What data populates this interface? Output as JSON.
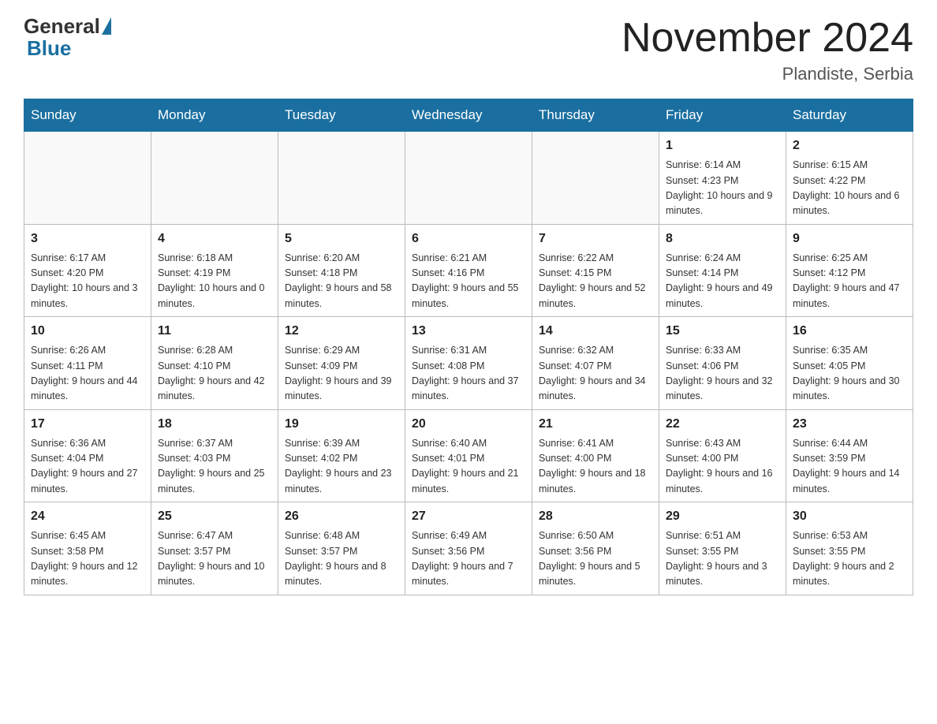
{
  "header": {
    "logo_general": "General",
    "logo_blue": "Blue",
    "month_title": "November 2024",
    "location": "Plandiste, Serbia"
  },
  "days_of_week": [
    "Sunday",
    "Monday",
    "Tuesday",
    "Wednesday",
    "Thursday",
    "Friday",
    "Saturday"
  ],
  "weeks": [
    [
      {
        "num": "",
        "info": ""
      },
      {
        "num": "",
        "info": ""
      },
      {
        "num": "",
        "info": ""
      },
      {
        "num": "",
        "info": ""
      },
      {
        "num": "",
        "info": ""
      },
      {
        "num": "1",
        "info": "Sunrise: 6:14 AM\nSunset: 4:23 PM\nDaylight: 10 hours and 9 minutes."
      },
      {
        "num": "2",
        "info": "Sunrise: 6:15 AM\nSunset: 4:22 PM\nDaylight: 10 hours and 6 minutes."
      }
    ],
    [
      {
        "num": "3",
        "info": "Sunrise: 6:17 AM\nSunset: 4:20 PM\nDaylight: 10 hours and 3 minutes."
      },
      {
        "num": "4",
        "info": "Sunrise: 6:18 AM\nSunset: 4:19 PM\nDaylight: 10 hours and 0 minutes."
      },
      {
        "num": "5",
        "info": "Sunrise: 6:20 AM\nSunset: 4:18 PM\nDaylight: 9 hours and 58 minutes."
      },
      {
        "num": "6",
        "info": "Sunrise: 6:21 AM\nSunset: 4:16 PM\nDaylight: 9 hours and 55 minutes."
      },
      {
        "num": "7",
        "info": "Sunrise: 6:22 AM\nSunset: 4:15 PM\nDaylight: 9 hours and 52 minutes."
      },
      {
        "num": "8",
        "info": "Sunrise: 6:24 AM\nSunset: 4:14 PM\nDaylight: 9 hours and 49 minutes."
      },
      {
        "num": "9",
        "info": "Sunrise: 6:25 AM\nSunset: 4:12 PM\nDaylight: 9 hours and 47 minutes."
      }
    ],
    [
      {
        "num": "10",
        "info": "Sunrise: 6:26 AM\nSunset: 4:11 PM\nDaylight: 9 hours and 44 minutes."
      },
      {
        "num": "11",
        "info": "Sunrise: 6:28 AM\nSunset: 4:10 PM\nDaylight: 9 hours and 42 minutes."
      },
      {
        "num": "12",
        "info": "Sunrise: 6:29 AM\nSunset: 4:09 PM\nDaylight: 9 hours and 39 minutes."
      },
      {
        "num": "13",
        "info": "Sunrise: 6:31 AM\nSunset: 4:08 PM\nDaylight: 9 hours and 37 minutes."
      },
      {
        "num": "14",
        "info": "Sunrise: 6:32 AM\nSunset: 4:07 PM\nDaylight: 9 hours and 34 minutes."
      },
      {
        "num": "15",
        "info": "Sunrise: 6:33 AM\nSunset: 4:06 PM\nDaylight: 9 hours and 32 minutes."
      },
      {
        "num": "16",
        "info": "Sunrise: 6:35 AM\nSunset: 4:05 PM\nDaylight: 9 hours and 30 minutes."
      }
    ],
    [
      {
        "num": "17",
        "info": "Sunrise: 6:36 AM\nSunset: 4:04 PM\nDaylight: 9 hours and 27 minutes."
      },
      {
        "num": "18",
        "info": "Sunrise: 6:37 AM\nSunset: 4:03 PM\nDaylight: 9 hours and 25 minutes."
      },
      {
        "num": "19",
        "info": "Sunrise: 6:39 AM\nSunset: 4:02 PM\nDaylight: 9 hours and 23 minutes."
      },
      {
        "num": "20",
        "info": "Sunrise: 6:40 AM\nSunset: 4:01 PM\nDaylight: 9 hours and 21 minutes."
      },
      {
        "num": "21",
        "info": "Sunrise: 6:41 AM\nSunset: 4:00 PM\nDaylight: 9 hours and 18 minutes."
      },
      {
        "num": "22",
        "info": "Sunrise: 6:43 AM\nSunset: 4:00 PM\nDaylight: 9 hours and 16 minutes."
      },
      {
        "num": "23",
        "info": "Sunrise: 6:44 AM\nSunset: 3:59 PM\nDaylight: 9 hours and 14 minutes."
      }
    ],
    [
      {
        "num": "24",
        "info": "Sunrise: 6:45 AM\nSunset: 3:58 PM\nDaylight: 9 hours and 12 minutes."
      },
      {
        "num": "25",
        "info": "Sunrise: 6:47 AM\nSunset: 3:57 PM\nDaylight: 9 hours and 10 minutes."
      },
      {
        "num": "26",
        "info": "Sunrise: 6:48 AM\nSunset: 3:57 PM\nDaylight: 9 hours and 8 minutes."
      },
      {
        "num": "27",
        "info": "Sunrise: 6:49 AM\nSunset: 3:56 PM\nDaylight: 9 hours and 7 minutes."
      },
      {
        "num": "28",
        "info": "Sunrise: 6:50 AM\nSunset: 3:56 PM\nDaylight: 9 hours and 5 minutes."
      },
      {
        "num": "29",
        "info": "Sunrise: 6:51 AM\nSunset: 3:55 PM\nDaylight: 9 hours and 3 minutes."
      },
      {
        "num": "30",
        "info": "Sunrise: 6:53 AM\nSunset: 3:55 PM\nDaylight: 9 hours and 2 minutes."
      }
    ]
  ]
}
